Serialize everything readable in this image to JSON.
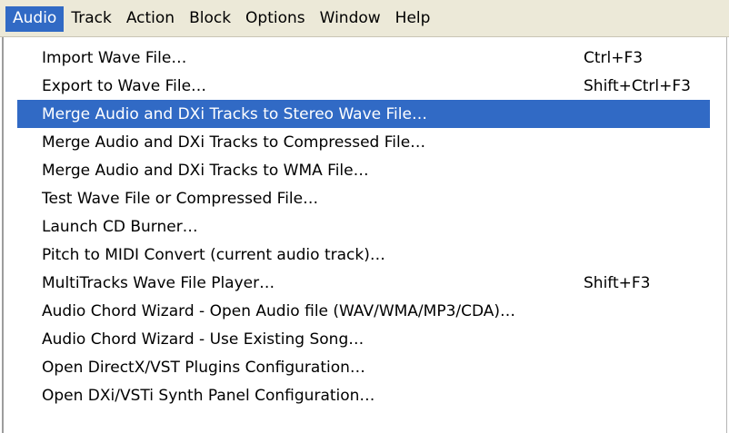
{
  "menubar": {
    "items": [
      {
        "label": "Audio",
        "active": true
      },
      {
        "label": "Track",
        "active": false
      },
      {
        "label": "Action",
        "active": false
      },
      {
        "label": "Block",
        "active": false
      },
      {
        "label": "Options",
        "active": false
      },
      {
        "label": "Window",
        "active": false
      },
      {
        "label": "Help",
        "active": false
      }
    ]
  },
  "audio_menu": {
    "items": [
      {
        "label": "Import Wave File…",
        "shortcut": "Ctrl+F3",
        "highlighted": false
      },
      {
        "label": "Export to Wave File…",
        "shortcut": "Shift+Ctrl+F3",
        "highlighted": false
      },
      {
        "label": "Merge Audio and DXi Tracks to Stereo Wave File…",
        "shortcut": "",
        "highlighted": true
      },
      {
        "label": "Merge Audio and DXi Tracks to Compressed File…",
        "shortcut": "",
        "highlighted": false
      },
      {
        "label": "Merge Audio and DXi Tracks to WMA File…",
        "shortcut": "",
        "highlighted": false
      },
      {
        "label": "Test Wave File or Compressed File…",
        "shortcut": "",
        "highlighted": false
      },
      {
        "label": "Launch CD Burner…",
        "shortcut": "",
        "highlighted": false
      },
      {
        "label": "Pitch to MIDI Convert (current audio track)…",
        "shortcut": "",
        "highlighted": false
      },
      {
        "label": "MultiTracks Wave File Player…",
        "shortcut": "Shift+F3",
        "highlighted": false
      },
      {
        "label": "Audio Chord Wizard - Open Audio file (WAV/WMA/MP3/CDA)…",
        "shortcut": "",
        "highlighted": false
      },
      {
        "label": "Audio Chord Wizard -  Use Existing Song…",
        "shortcut": "",
        "highlighted": false
      },
      {
        "label": "Open DirectX/VST Plugins Configuration…",
        "shortcut": "",
        "highlighted": false
      },
      {
        "label": "Open DXi/VSTi Synth Panel Configuration…",
        "shortcut": "",
        "highlighted": false
      }
    ]
  },
  "colors": {
    "highlight": "#316ac5",
    "menubar_bg": "#ece9d8",
    "menu_bg": "#ffffff"
  }
}
